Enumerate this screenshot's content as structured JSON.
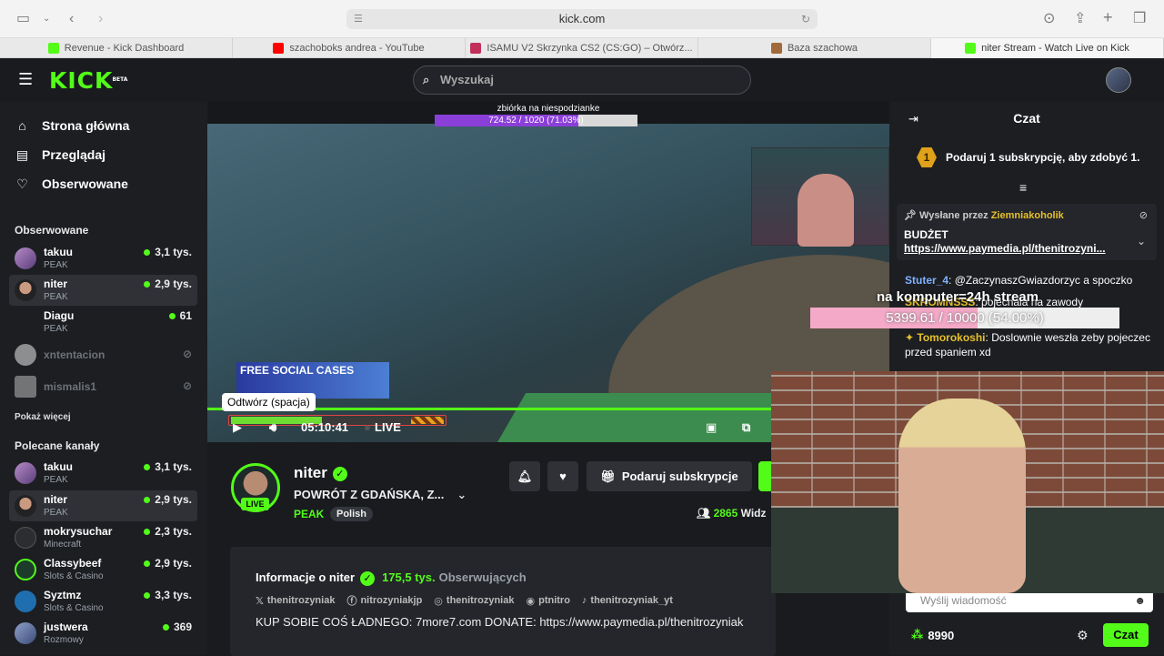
{
  "browser": {
    "url": "kick.com",
    "tabs": [
      {
        "label": "Revenue - Kick Dashboard",
        "color": "#53fc18"
      },
      {
        "label": "szachoboks andrea - YouTube",
        "color": "#ff0000"
      },
      {
        "label": "ISAMU V2 Skrzynka CS2 (CS:GO) – Otwórz...",
        "color": "#c0305a"
      },
      {
        "label": "Baza szachowa",
        "color": "#a06a3a"
      },
      {
        "label": "niter Stream - Watch Live on Kick",
        "color": "#53fc18"
      }
    ]
  },
  "header": {
    "logo": "KICK",
    "beta": "BETA",
    "search_placeholder": "Wyszukaj"
  },
  "nav": {
    "home": "Strona główna",
    "browse": "Przeglądaj",
    "following": "Obserwowane"
  },
  "sidebar": {
    "followed_title": "Obserwowane",
    "followed": [
      {
        "name": "takuu",
        "category": "PEAK",
        "viewers": "3,1 tys.",
        "live": true
      },
      {
        "name": "niter",
        "category": "PEAK",
        "viewers": "2,9 tys.",
        "live": true
      },
      {
        "name": "Diagu",
        "category": "PEAK",
        "viewers": "61",
        "live": true
      },
      {
        "name": "xntentacion",
        "category": "",
        "viewers": "",
        "live": false
      },
      {
        "name": "mismalis1",
        "category": "",
        "viewers": "",
        "live": false
      }
    ],
    "show_more": "Pokaż więcej",
    "recommended_title": "Polecane kanały",
    "recommended": [
      {
        "name": "takuu",
        "category": "PEAK",
        "viewers": "3,1 tys."
      },
      {
        "name": "niter",
        "category": "PEAK",
        "viewers": "2,9 tys."
      },
      {
        "name": "mokrysuchar",
        "category": "Minecraft",
        "viewers": "2,3 tys."
      },
      {
        "name": "Classybeef",
        "category": "Slots & Casino",
        "viewers": "2,9 tys."
      },
      {
        "name": "Syztmz",
        "category": "Slots & Casino",
        "viewers": "3,3 tys."
      },
      {
        "name": "justwera",
        "category": "Rozmowy",
        "viewers": "369"
      }
    ]
  },
  "video": {
    "goal_title": "zbiórka na niespodzianke",
    "goal_text": "724.52 / 1020 (71.03%)",
    "goal_fraction": 0.7103,
    "promo": "FREE SOCIAL CASES",
    "tooltip": "Odtwórz (spacja)",
    "time": "05:10:41",
    "live": "LIVE"
  },
  "channel": {
    "name": "niter",
    "live_badge": "LIVE",
    "title": "POWRÓT Z GDAŃSKA, Z...",
    "category": "PEAK",
    "tag": "Polish",
    "sub_button": "Podaruj subskrypcje",
    "viewers_count": "2865",
    "viewers_label": "Widz"
  },
  "about": {
    "title": "Informacje o niter",
    "followers": "175,5 tys.",
    "followers_label": "Obserwujących",
    "socials": [
      "thenitrozyniak",
      "nitrozyniakjp",
      "thenitrozyniak",
      "ptnitro",
      "thenitrozyniak_yt"
    ],
    "description": "KUP SOBIE COŚ ŁADNEGO: 7more7.com DONATE: https://www.paymedia.pl/thenitrozyniak"
  },
  "chat": {
    "title": "Czat",
    "promo_count": "1",
    "promo": "Podaruj 1 subskrypcję, aby zdobyć 1.",
    "pinned_label": "Wysłane przez",
    "pinned_user": "Ziemniakoholik",
    "pinned_line1": "BUDŻET",
    "pinned_line2": "https://www.paymedia.pl/thenitrozyni...",
    "messages": [
      {
        "user": "Stuter_4",
        "color": "#7fb2ff",
        "text": "@ZaczynaszGwiazdorzyc a spoczko"
      },
      {
        "user": "SKROMNSSS",
        "color": "#e6c02a",
        "text": "pojechala na zawody"
      },
      {
        "user": "Tomorokoshi",
        "color": "#e6c02a",
        "text": "Doslownie weszła zeby pojeczec przed spaniem xd"
      }
    ],
    "input_placeholder": "Wyślij wiadomość",
    "points": "8990",
    "send": "Czat"
  },
  "overlay": {
    "goal_title": "na komputer=24h stream",
    "goal_text": "5399.61 / 10000 (54.00%)",
    "goal_fraction": 0.54
  }
}
